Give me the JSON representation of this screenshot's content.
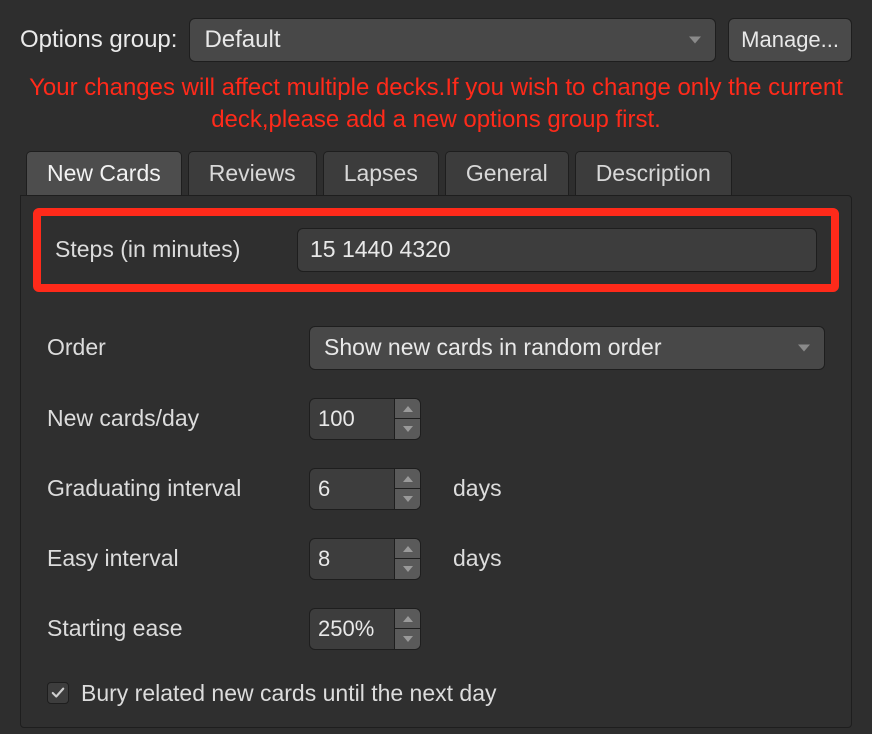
{
  "header": {
    "options_group_label": "Options group:",
    "options_group_value": "Default",
    "manage_label": "Manage..."
  },
  "warning_text": "Your changes will affect multiple decks.If you wish to change only the current deck,please add a new options group first.",
  "tabs": {
    "new_cards": "New Cards",
    "reviews": "Reviews",
    "lapses": "Lapses",
    "general": "General",
    "description": "Description"
  },
  "form": {
    "steps_label": "Steps (in minutes)",
    "steps_value": "15 1440 4320",
    "order_label": "Order",
    "order_value": "Show new cards in random order",
    "new_per_day_label": "New cards/day",
    "new_per_day_value": "100",
    "grad_interval_label": "Graduating interval",
    "grad_interval_value": "6",
    "easy_interval_label": "Easy interval",
    "easy_interval_value": "8",
    "days_suffix": "days",
    "starting_ease_label": "Starting ease",
    "starting_ease_value": "250%",
    "bury_label": "Bury related new cards until the next day",
    "bury_checked": true
  }
}
